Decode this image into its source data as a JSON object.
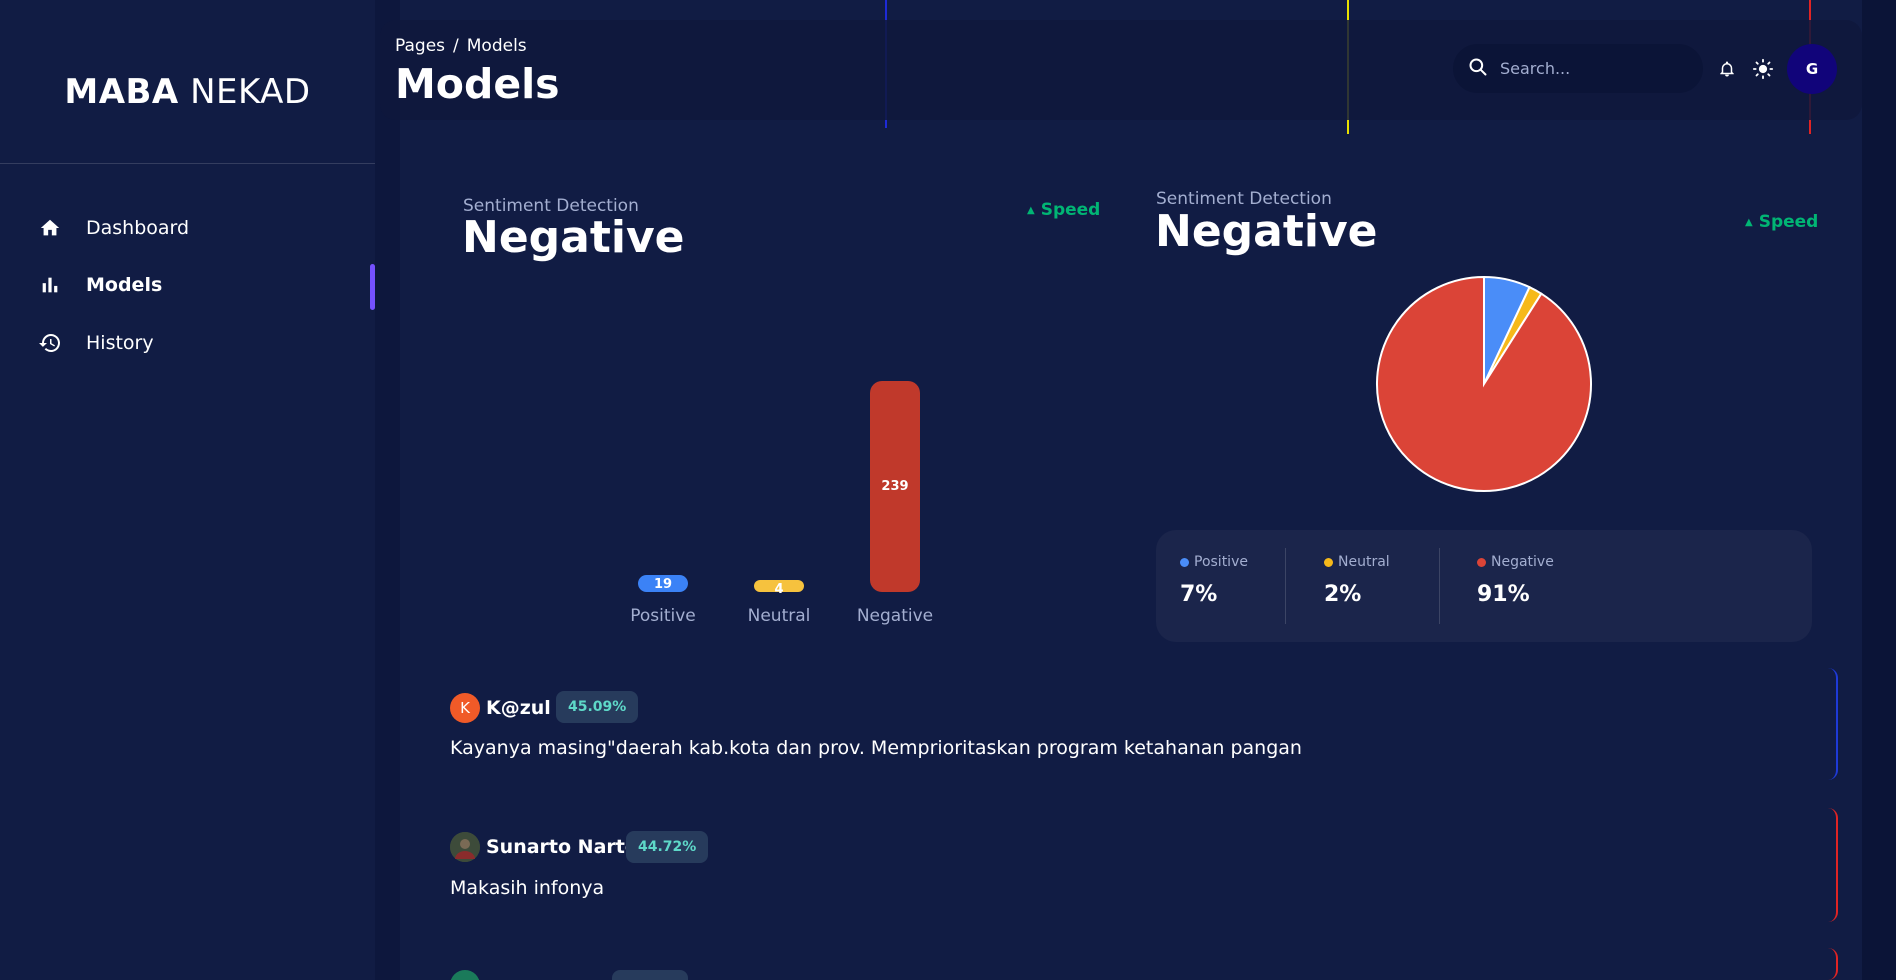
{
  "sidebar": {
    "brand_bold": "MABA",
    "brand_light": "NEKAD",
    "items": [
      {
        "label": "Dashboard",
        "icon": "home-icon",
        "active": false
      },
      {
        "label": "Models",
        "icon": "bar-chart-icon",
        "active": true
      },
      {
        "label": "History",
        "icon": "history-icon",
        "active": false
      }
    ]
  },
  "navbar": {
    "breadcrumb_root": "Pages",
    "breadcrumb_sep": "/",
    "breadcrumb_current": "Models",
    "title": "Models",
    "search_placeholder": "Search...",
    "avatar_initial": "G"
  },
  "bar_card": {
    "subtitle": "Sentiment Detection",
    "headline": "Negative",
    "speed_label": "Speed"
  },
  "pie_card": {
    "subtitle": "Sentiment Detection",
    "headline": "Negative",
    "speed_label": "Speed"
  },
  "chart_data": [
    {
      "type": "bar",
      "categories": [
        "Positive",
        "Neutral",
        "Negative"
      ],
      "values": [
        19,
        4,
        239
      ],
      "data_labels": [
        "19",
        "4",
        "239"
      ],
      "colors": [
        "#3b82f6",
        "#f6c23e",
        "#c0392b"
      ],
      "title": "",
      "xlabel": "",
      "ylabel": "",
      "ylim": [
        0,
        239
      ],
      "grid": false
    },
    {
      "type": "pie",
      "categories": [
        "Positive",
        "Neutral",
        "Negative"
      ],
      "values": [
        7,
        2,
        91
      ],
      "colors": [
        "#4a8df8",
        "#f6b91a",
        "#db4437"
      ],
      "title": ""
    }
  ],
  "legend": [
    {
      "label": "Positive",
      "value": "7%",
      "color": "#4a8df8"
    },
    {
      "label": "Neutral",
      "value": "2%",
      "color": "#f6b91a"
    },
    {
      "label": "Negative",
      "value": "91%",
      "color": "#db4437"
    }
  ],
  "comments": [
    {
      "author": "K@zul",
      "initial": "K",
      "avatar_color": "#f05a28",
      "score": "45.09%",
      "text": "Kayanya masing\"daerah kab.kota dan prov. Memprioritaskan program ketahanan pangan",
      "accent": "#1e3ad8"
    },
    {
      "author": "Sunarto Narto",
      "initial": "",
      "avatar_color": "#3d4b3a",
      "score": "44.72%",
      "text": "Makasih infonya",
      "accent": "#e02424"
    }
  ],
  "colors": {
    "background": "#0b1437",
    "panel": "#111c44",
    "accent_purple": "#7551ff",
    "speed_green": "#01b574",
    "muted_text": "#a3aed0"
  }
}
